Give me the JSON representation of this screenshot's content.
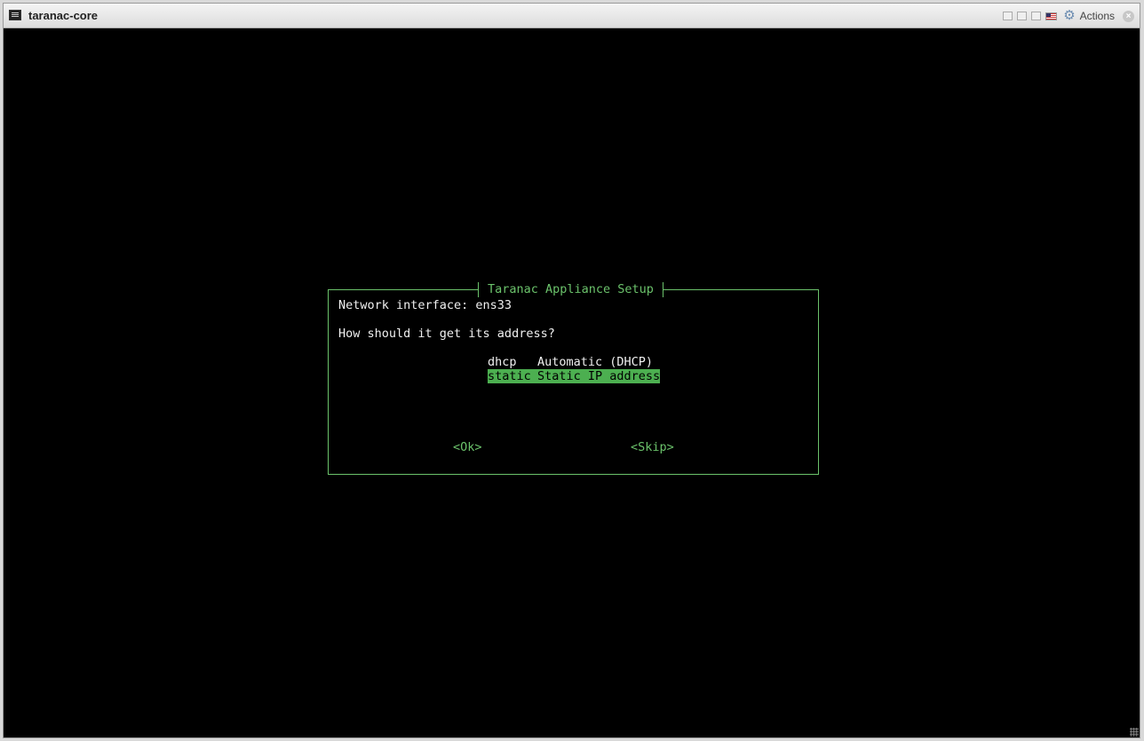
{
  "window": {
    "title": "taranac-core",
    "actions_label": "Actions",
    "close_glyph": "×"
  },
  "dialog": {
    "title": "Taranac Appliance Setup",
    "interface_line": "Network interface: ens33",
    "question": "How should it get its address?",
    "options": [
      {
        "key": "dhcp",
        "label": "Automatic (DHCP)",
        "selected": false
      },
      {
        "key": "static",
        "label": "Static IP address",
        "selected": true
      }
    ],
    "ok_button": "<Ok>",
    "skip_button": "<Skip>"
  },
  "colors": {
    "terminal_bg": "#000000",
    "accent_green": "#6bc26b",
    "selection_green": "#4caf50",
    "text": "#f0f0f0"
  },
  "icons": [
    "console-icon",
    "flag-icon",
    "gear-icon",
    "close-icon"
  ]
}
